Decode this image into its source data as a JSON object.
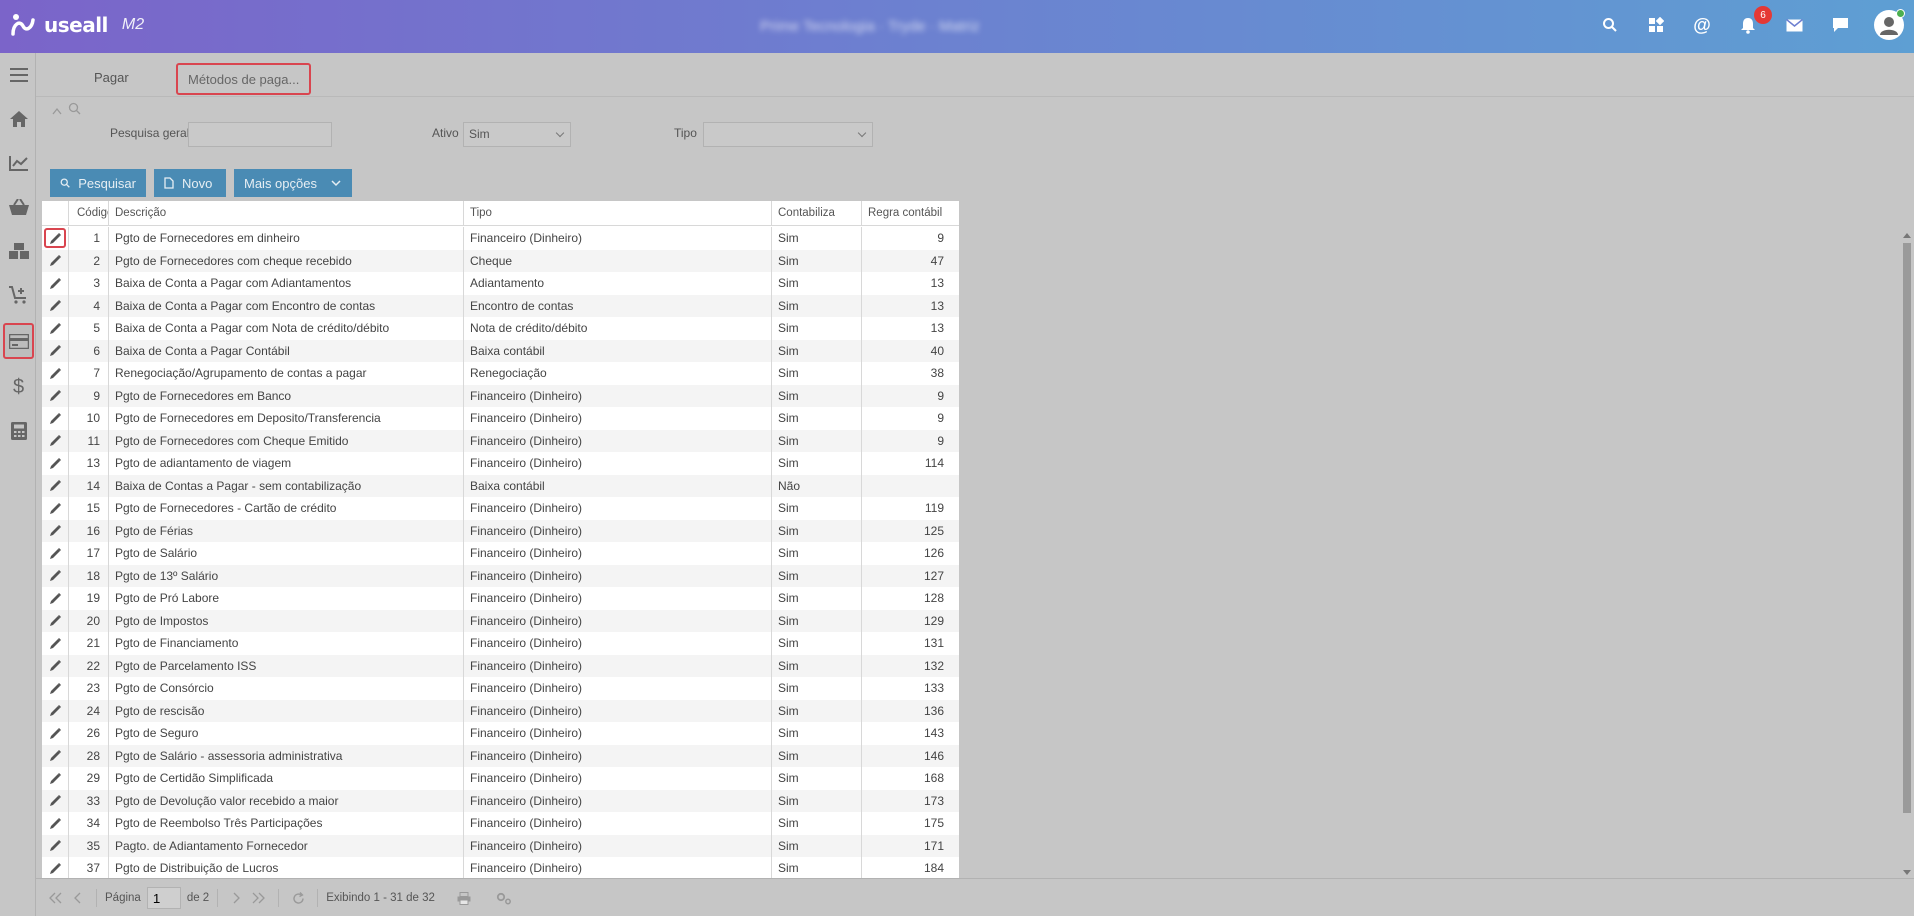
{
  "header": {
    "logo_text": "useall",
    "logo_sub": "M2",
    "company": "Prime Tecnologia · Tryde · Matriz",
    "notifications_count": "6"
  },
  "tabs": [
    {
      "label": "Pagar"
    },
    {
      "label": "Métodos de paga..."
    }
  ],
  "filters": {
    "general_search_label": "Pesquisa geral",
    "general_search_value": "",
    "active_label": "Ativo",
    "active_value": "Sim",
    "type_label": "Tipo",
    "type_value": ""
  },
  "toolbar": {
    "search_label": "Pesquisar",
    "new_label": "Novo",
    "more_label": "Mais opções"
  },
  "table": {
    "headers": [
      "Código",
      "Descrição",
      "Tipo",
      "Contabiliza",
      "Regra contábil"
    ],
    "rows": [
      [
        "1",
        "Pgto de Fornecedores em dinheiro",
        "Financeiro (Dinheiro)",
        "Sim",
        "9"
      ],
      [
        "2",
        "Pgto de Fornecedores com cheque recebido",
        "Cheque",
        "Sim",
        "47"
      ],
      [
        "3",
        "Baixa de Conta a Pagar com Adiantamentos",
        "Adiantamento",
        "Sim",
        "13"
      ],
      [
        "4",
        "Baixa de Conta a Pagar com Encontro de contas",
        "Encontro de contas",
        "Sim",
        "13"
      ],
      [
        "5",
        "Baixa de Conta a Pagar com Nota de crédito/débito",
        "Nota de crédito/débito",
        "Sim",
        "13"
      ],
      [
        "6",
        "Baixa de Conta a Pagar Contábil",
        "Baixa contábil",
        "Sim",
        "40"
      ],
      [
        "7",
        "Renegociação/Agrupamento de contas a pagar",
        "Renegociação",
        "Sim",
        "38"
      ],
      [
        "9",
        "Pgto de Fornecedores em Banco",
        "Financeiro (Dinheiro)",
        "Sim",
        "9"
      ],
      [
        "10",
        "Pgto de Fornecedores em Deposito/Transferencia",
        "Financeiro (Dinheiro)",
        "Sim",
        "9"
      ],
      [
        "11",
        "Pgto de Fornecedores com Cheque Emitido",
        "Financeiro (Dinheiro)",
        "Sim",
        "9"
      ],
      [
        "13",
        "Pgto de adiantamento de viagem",
        "Financeiro (Dinheiro)",
        "Sim",
        "114"
      ],
      [
        "14",
        "Baixa de Contas a Pagar - sem contabilização",
        "Baixa contábil",
        "Não",
        ""
      ],
      [
        "15",
        "Pgto de Fornecedores - Cartão de crédito",
        "Financeiro (Dinheiro)",
        "Sim",
        "119"
      ],
      [
        "16",
        "Pgto de Férias",
        "Financeiro (Dinheiro)",
        "Sim",
        "125"
      ],
      [
        "17",
        "Pgto de Salário",
        "Financeiro (Dinheiro)",
        "Sim",
        "126"
      ],
      [
        "18",
        "Pgto de 13º Salário",
        "Financeiro (Dinheiro)",
        "Sim",
        "127"
      ],
      [
        "19",
        "Pgto de Pró Labore",
        "Financeiro (Dinheiro)",
        "Sim",
        "128"
      ],
      [
        "20",
        "Pgto de Impostos",
        "Financeiro (Dinheiro)",
        "Sim",
        "129"
      ],
      [
        "21",
        "Pgto de Financiamento",
        "Financeiro (Dinheiro)",
        "Sim",
        "131"
      ],
      [
        "22",
        "Pgto de Parcelamento ISS",
        "Financeiro (Dinheiro)",
        "Sim",
        "132"
      ],
      [
        "23",
        "Pgto de Consórcio",
        "Financeiro (Dinheiro)",
        "Sim",
        "133"
      ],
      [
        "24",
        "Pgto de rescisão",
        "Financeiro (Dinheiro)",
        "Sim",
        "136"
      ],
      [
        "26",
        "Pgto de Seguro",
        "Financeiro (Dinheiro)",
        "Sim",
        "143"
      ],
      [
        "28",
        "Pgto de Salário - assessoria administrativa",
        "Financeiro (Dinheiro)",
        "Sim",
        "146"
      ],
      [
        "29",
        "Pgto de Certidão Simplificada",
        "Financeiro (Dinheiro)",
        "Sim",
        "168"
      ],
      [
        "33",
        "Pgto de Devolução valor recebido a maior",
        "Financeiro (Dinheiro)",
        "Sim",
        "173"
      ],
      [
        "34",
        "Pgto de Reembolso Três Participações",
        "Financeiro (Dinheiro)",
        "Sim",
        "175"
      ],
      [
        "35",
        "Pagto. de Adiantamento Fornecedor",
        "Financeiro (Dinheiro)",
        "Sim",
        "171"
      ],
      [
        "37",
        "Pgto de Distribuição de Lucros",
        "Financeiro (Dinheiro)",
        "Sim",
        "184"
      ]
    ]
  },
  "pager": {
    "page_label": "Página",
    "page_value": "1",
    "of_label": "de 2",
    "showing": "Exibindo 1 - 31 de 32"
  },
  "colors": {
    "accent": "#4a8bb4",
    "highlight": "#d9454f",
    "topbar_start": "#7b64c9",
    "topbar_end": "#5e9fd3"
  }
}
